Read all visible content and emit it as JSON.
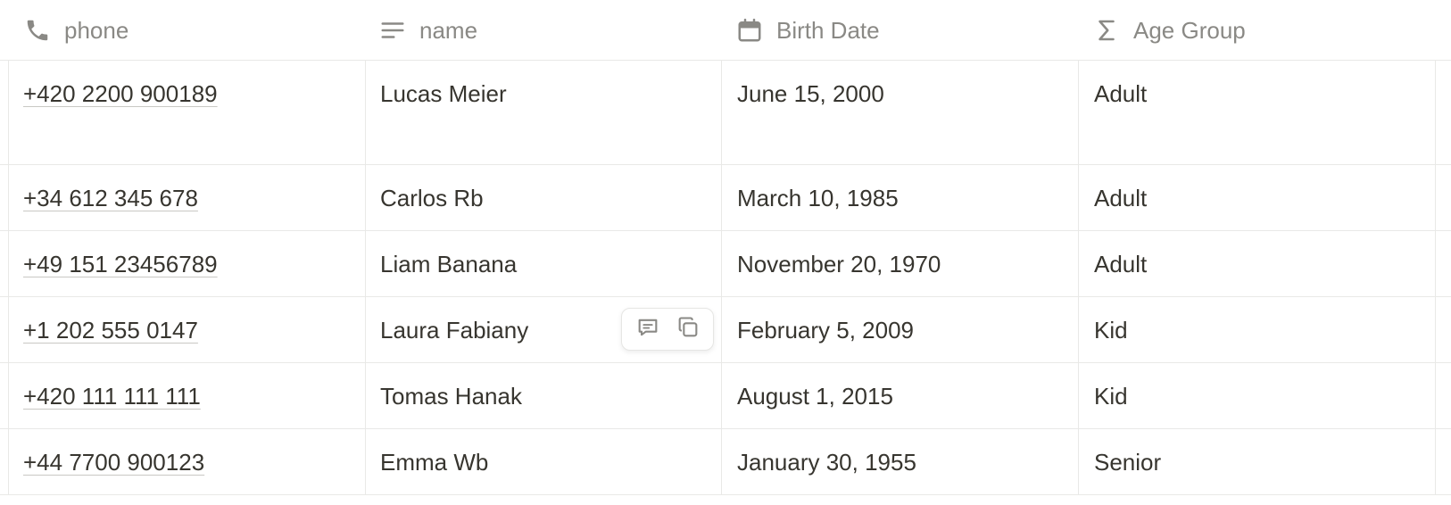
{
  "columns": {
    "phone": {
      "label": "phone",
      "icon": "phone-icon"
    },
    "name": {
      "label": "name",
      "icon": "text-lines-icon"
    },
    "birth_date": {
      "label": "Birth Date",
      "icon": "calendar-icon"
    },
    "age_group": {
      "label": "Age Group",
      "icon": "sigma-formula-icon"
    }
  },
  "rows": [
    {
      "phone": "+420 2200 900189",
      "name": "Lucas Meier",
      "birth_date": "June 15, 2000",
      "age_group": "Adult"
    },
    {
      "phone": "+34 612 345 678",
      "name": "Carlos Rb",
      "birth_date": "March 10, 1985",
      "age_group": "Adult"
    },
    {
      "phone": "+49 151 23456789",
      "name": "Liam Banana",
      "birth_date": "November 20, 1970",
      "age_group": "Adult"
    },
    {
      "phone": "+1 202 555 0147",
      "name": "Laura Fabiany",
      "birth_date": "February 5, 2009",
      "age_group": "Kid"
    },
    {
      "phone": "+420 111 111 111",
      "name": "Tomas Hanak",
      "birth_date": "August 1, 2015",
      "age_group": "Kid"
    },
    {
      "phone": "+44 7700 900123",
      "name": "Emma Wb",
      "birth_date": "January 30, 1955",
      "age_group": "Senior"
    }
  ],
  "row_actions": {
    "comment_icon": "comment-icon",
    "duplicate_icon": "duplicate-icon"
  },
  "colors": {
    "text": "#37352f",
    "header_text": "#8a8985",
    "border": "#e9e9e7",
    "link_underline": "#c9c8c4"
  }
}
